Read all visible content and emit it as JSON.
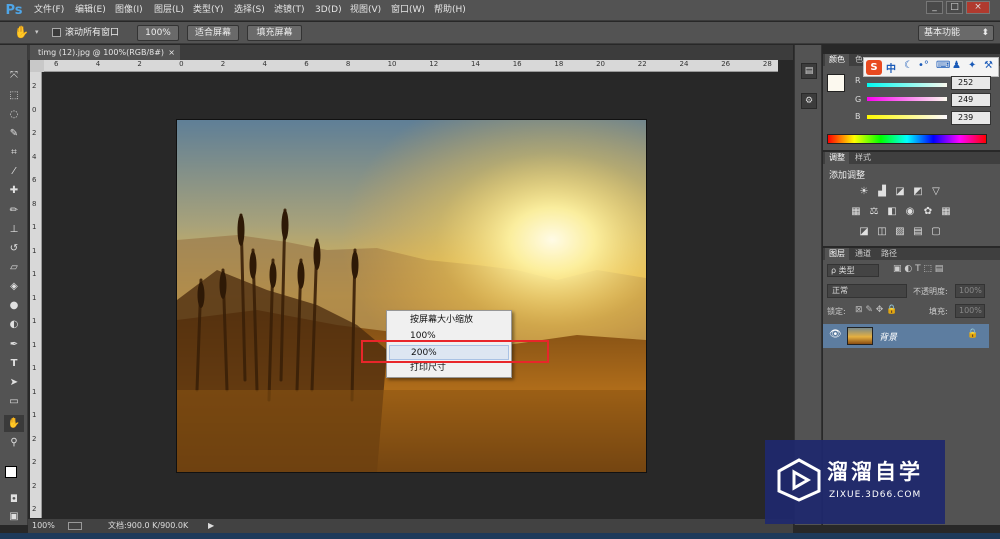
{
  "app": {
    "logo": "Ps"
  },
  "menu": [
    "文件(F)",
    "编辑(E)",
    "图像(I)",
    "图层(L)",
    "类型(Y)",
    "选择(S)",
    "滤镜(T)",
    "3D(D)",
    "视图(V)",
    "窗口(W)",
    "帮助(H)"
  ],
  "window_controls": {
    "minimize": "_",
    "restore": "□",
    "close": "×"
  },
  "options": {
    "scroll_all_windows": "滚动所有窗口",
    "zoom_100": "100%",
    "fit_screen": "适合屏幕",
    "fill_screen": "填充屏幕",
    "workspace": "基本功能"
  },
  "document": {
    "tab_title": "timg (12).jpg @ 100%(RGB/8#)",
    "close": "×"
  },
  "ruler": {
    "h": [
      "6",
      "4",
      "2",
      "0",
      "2",
      "4",
      "6",
      "8",
      "10",
      "12",
      "14",
      "16",
      "18",
      "20",
      "22",
      "24",
      "26",
      "28"
    ],
    "v": [
      "2",
      "0",
      "2",
      "4",
      "6",
      "8",
      "1",
      "1",
      "1",
      "1",
      "1",
      "1",
      "1",
      "1",
      "1",
      "2",
      "2",
      "2",
      "2"
    ]
  },
  "context_menu": {
    "items": [
      "按屏幕大小缩放",
      "100%",
      "200%",
      "打印尺寸"
    ],
    "highlighted": "200%"
  },
  "status": {
    "zoom": "100%",
    "doc": "文档:900.0 K/900.0K",
    "arrow": "▶"
  },
  "panels": {
    "color": {
      "tabs": [
        "颜色",
        "色"
      ],
      "ime": [
        "S",
        "中"
      ],
      "channels": [
        {
          "label": "R",
          "value": "252"
        },
        {
          "label": "G",
          "value": "249"
        },
        {
          "label": "B",
          "value": "239"
        }
      ],
      "foreground": "#fcf9ef"
    },
    "adjust": {
      "tabs": [
        "调整",
        "样式"
      ],
      "title": "添加调整"
    },
    "layers": {
      "tabs": [
        "图层",
        "通道",
        "路径"
      ],
      "filter": "ρ 类型",
      "blend": "正常",
      "opacity_label": "不透明度:",
      "opacity": "100%",
      "lock_label": "锁定:",
      "fill_label": "填充:",
      "fill": "100%",
      "layer_name": "背景"
    }
  },
  "watermark": {
    "brand": "溜溜自学",
    "url": "ZIXUE.3D66.COM"
  },
  "colors": {
    "accent": "#4fa6e8",
    "highlight_box": "#e8262a"
  }
}
